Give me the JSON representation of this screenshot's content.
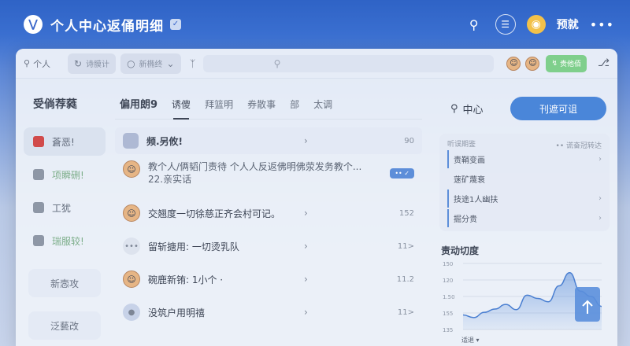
{
  "topbar": {
    "title": "个人中心返俑明细",
    "profile_label": "预就"
  },
  "toolbar": {
    "search_label": "个人",
    "pills": [
      "诗膜计",
      "新椭终"
    ],
    "green_btn": "贵他佰"
  },
  "sidebar": {
    "title": "受倘荐蕤",
    "items": [
      {
        "label": "蒼恶!",
        "active": true
      },
      {
        "label": "项瞬硎!",
        "tint": true
      },
      {
        "label": "工犹"
      },
      {
        "label": "瑞服较!",
        "tint": true
      }
    ],
    "buttons": [
      "新悫攻",
      "泛藝改"
    ]
  },
  "main": {
    "tabs": [
      "偏用朗9",
      "诱傻",
      "拜篮明",
      "券散事",
      "部",
      "太调"
    ],
    "rows": [
      {
        "text": "频.另攸!",
        "arrow": "›",
        "num": "90"
      },
      {
        "text": "教个人/俩韬门责待 个人人反返佛明佛荥发务教个...",
        "text2": "22.亲实话",
        "badge": "•• ✓"
      },
      {
        "text": "交翘度一切徐慈正齐会村可记。",
        "arrow": "›",
        "num": "152"
      },
      {
        "text": "留斩搪用: 一切烫乳队",
        "arrow": "›",
        "num": "11>"
      },
      {
        "text": "碗鹿新铕: 1小个 ·",
        "arrow": "›",
        "num": "11.2"
      },
      {
        "text": "没筑户用明禧",
        "arrow": "›",
        "num": "11>"
      }
    ]
  },
  "right": {
    "search_label": "中心",
    "primary_btn": "刊遮可诅",
    "card_sub": "听误期鉴",
    "card_link": "•• 谎奋冠转达",
    "items": [
      {
        "label": "责鞘变画",
        "bar": true
      },
      {
        "label": "蒾矿蔑衰",
        "bar": false
      },
      {
        "label": "技途1人幽扶",
        "bar": true
      },
      {
        "label": "掘分贵",
        "bar": true
      }
    ],
    "chart_title": "责动切度"
  },
  "chart_data": {
    "type": "area",
    "title": "责动切度",
    "yticks": [
      "150",
      "120",
      "1.50",
      "155",
      "135"
    ],
    "xlabel": "适退",
    "values": [
      22,
      18,
      26,
      31,
      38,
      30,
      52,
      47,
      42,
      66,
      86,
      58,
      50,
      35
    ],
    "ylim": [
      0,
      100
    ]
  }
}
